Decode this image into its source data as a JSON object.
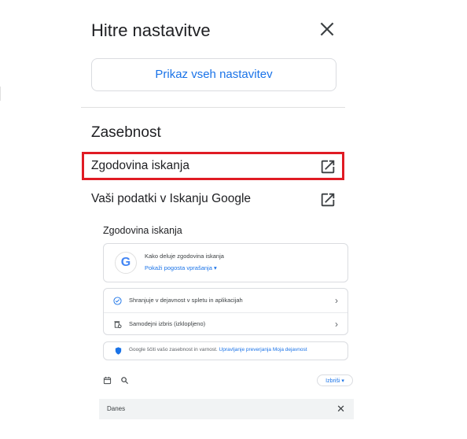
{
  "panel": {
    "title": "Hitre nastavitve",
    "all_settings_label": "Prikaz vseh nastavitev"
  },
  "privacy": {
    "section_title": "Zasebnost",
    "links": [
      {
        "label": "Zgodovina iskanja",
        "icon": "open-in-new-icon",
        "highlighted": true
      },
      {
        "label": "Vaši podatki v Iskanju Google",
        "icon": "open-in-new-icon",
        "highlighted": false
      }
    ]
  },
  "preview": {
    "title": "Zgodovina iskanja",
    "how_it_works": {
      "title": "Kako deluje zgodovina iskanja",
      "faq_label": "Pokaži pogosta vprašanja ▾"
    },
    "settings": [
      {
        "label": "Shranjuje v dejavnost v spletu in aplikacijah",
        "icon": "check-circle-icon"
      },
      {
        "label": "Samodejni izbris (izklopljeno)",
        "icon": "auto-delete-icon"
      }
    ],
    "note": {
      "text": "Google ščiti vašo zasebnost in varnost.",
      "link1": "Upravljanje preverjanja",
      "link2": "Moja dejavnost"
    },
    "delete_label": "Izbriši ▾",
    "today_label": "Danes"
  },
  "colors": {
    "accent": "#1a73e8",
    "highlight": "#e01b24",
    "text": "#202124",
    "divider": "#e0e0e0"
  }
}
